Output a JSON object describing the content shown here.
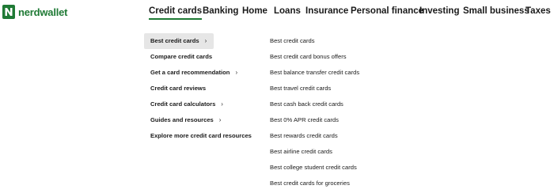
{
  "brand": {
    "name": "nerdwallet",
    "color": "#1f7a35"
  },
  "nav": {
    "items": [
      "Credit cards",
      "Banking",
      "Home",
      "Loans",
      "Insurance",
      "Personal finance",
      "Investing",
      "Small business",
      "Taxes"
    ],
    "active": "Credit cards"
  },
  "submenu": {
    "categories": [
      {
        "label": "Best credit cards",
        "chevron": true,
        "selected": true
      },
      {
        "label": "Compare credit cards",
        "chevron": false
      },
      {
        "label": "Get a card recommendation",
        "chevron": true
      },
      {
        "label": "Credit card reviews",
        "chevron": false
      },
      {
        "label": "Credit card calculators",
        "chevron": true
      },
      {
        "label": "Guides and resources",
        "chevron": true
      },
      {
        "label": "Explore more credit card resources",
        "chevron": false
      }
    ],
    "links": [
      "Best credit cards",
      "Best credit card bonus offers",
      "Best balance transfer credit cards",
      "Best travel credit cards",
      "Best cash back credit cards",
      "Best 0% APR credit cards",
      "Best rewards credit cards",
      "Best airline credit cards",
      "Best college student credit cards",
      "Best credit cards for groceries"
    ],
    "chevron_glyph": "›"
  }
}
